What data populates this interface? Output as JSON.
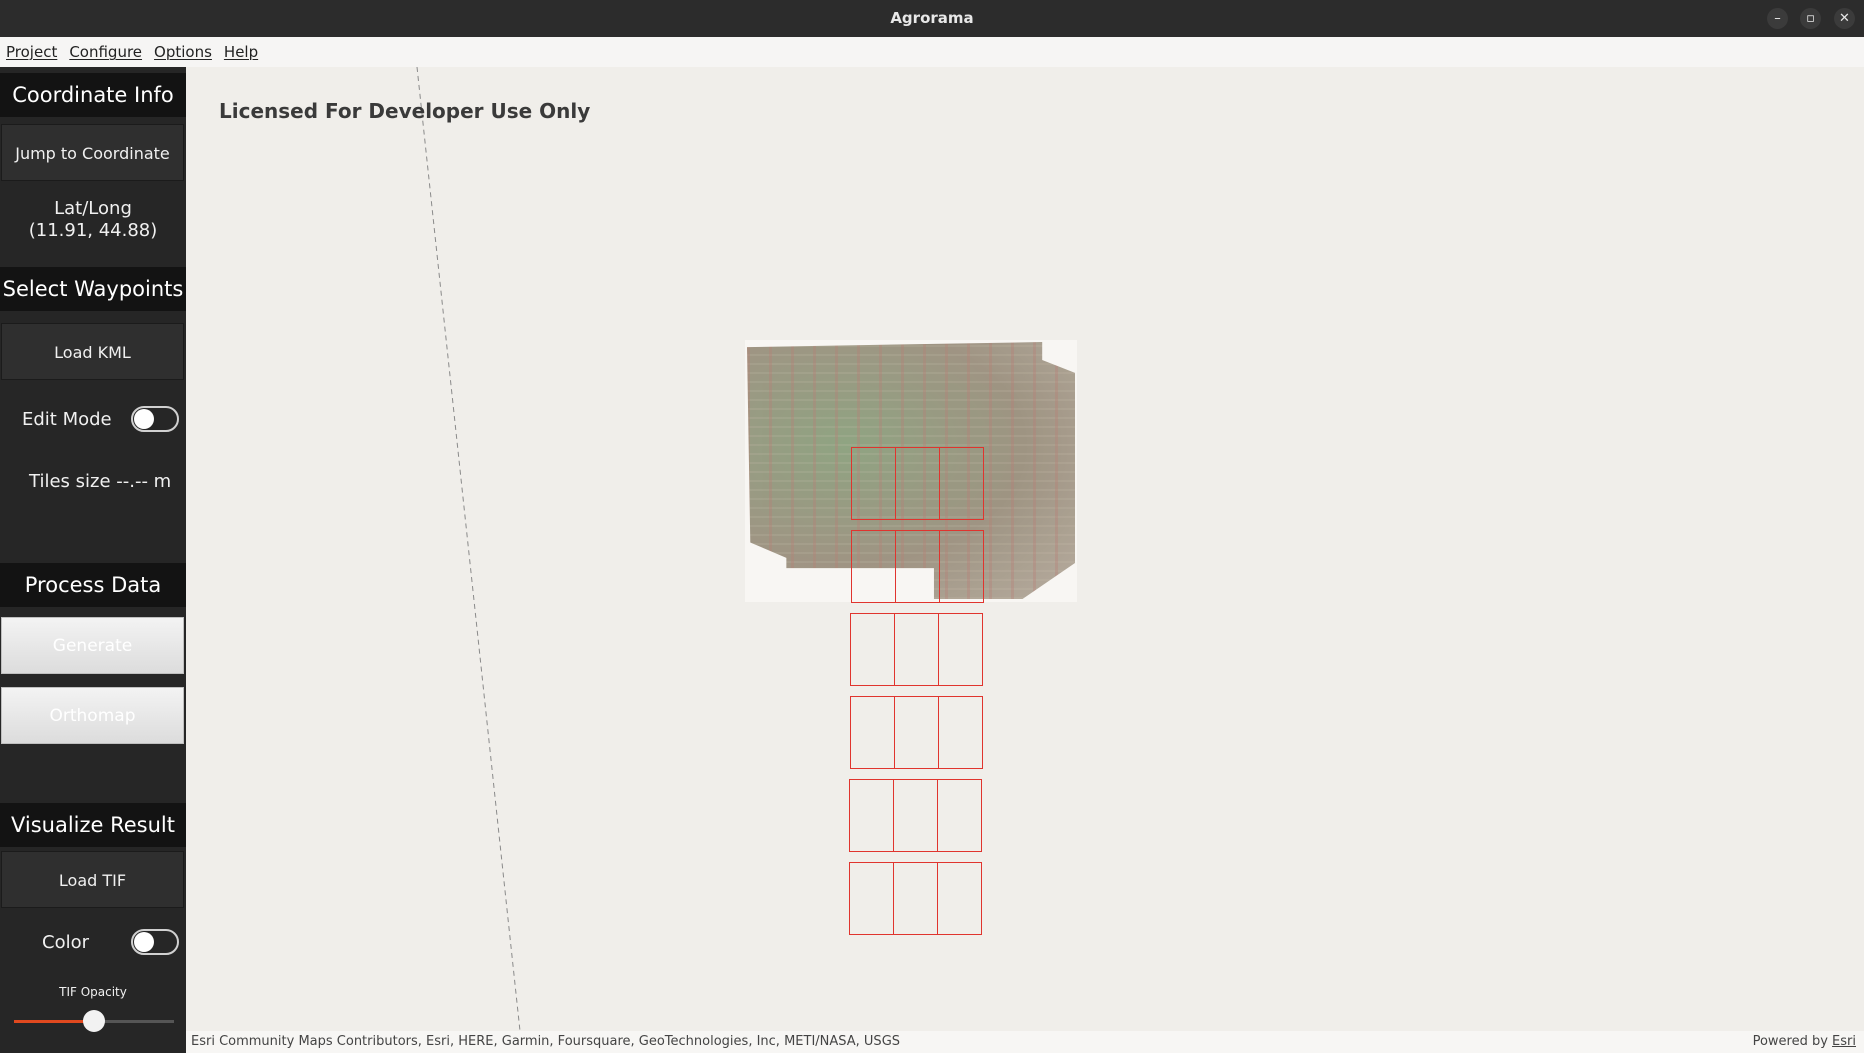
{
  "window": {
    "title": "Agrorama",
    "controls": {
      "minimize": "–",
      "maximize": "▫",
      "close": "✕"
    }
  },
  "menu": [
    "Project",
    "Configure",
    "Options",
    "Help"
  ],
  "sidebar": {
    "coordinate_info": {
      "header": "Coordinate Info",
      "jump_button": "Jump to Coordinate",
      "latlong_label": "Lat/Long",
      "latlong_value": "(11.91, 44.88)"
    },
    "select_waypoints": {
      "header": "Select Waypoints",
      "load_kml_button": "Load KML",
      "edit_mode_label": "Edit Mode",
      "edit_mode_on": false,
      "tiles_size_text": "Tiles size --.-- m"
    },
    "process_data": {
      "header": "Process Data",
      "generate_button": "Generate",
      "orthomap_button": "Orthomap"
    },
    "visualize_result": {
      "header": "Visualize Result",
      "load_tif_button": "Load TIF",
      "color_label": "Color",
      "color_on": false,
      "opacity_label": "TIF Opacity",
      "opacity_value": 0.5
    }
  },
  "map": {
    "watermark": "Licensed For Developer Use Only",
    "attribution": "Esri Community Maps Contributors, Esri, HERE, Garmin, Foursquare, GeoTechnologies, Inc, METI/NASA, USGS",
    "powered_by_prefix": "Powered by ",
    "powered_by_link": "Esri",
    "tile_grid": {
      "rows": 6,
      "columns": 3
    },
    "tile_color": "#e0342e"
  },
  "colors": {
    "sidebar_bg": "#262626",
    "section_header_bg": "#131313",
    "slider_accent": "#e0491f",
    "map_bg": "#f0eeea"
  }
}
